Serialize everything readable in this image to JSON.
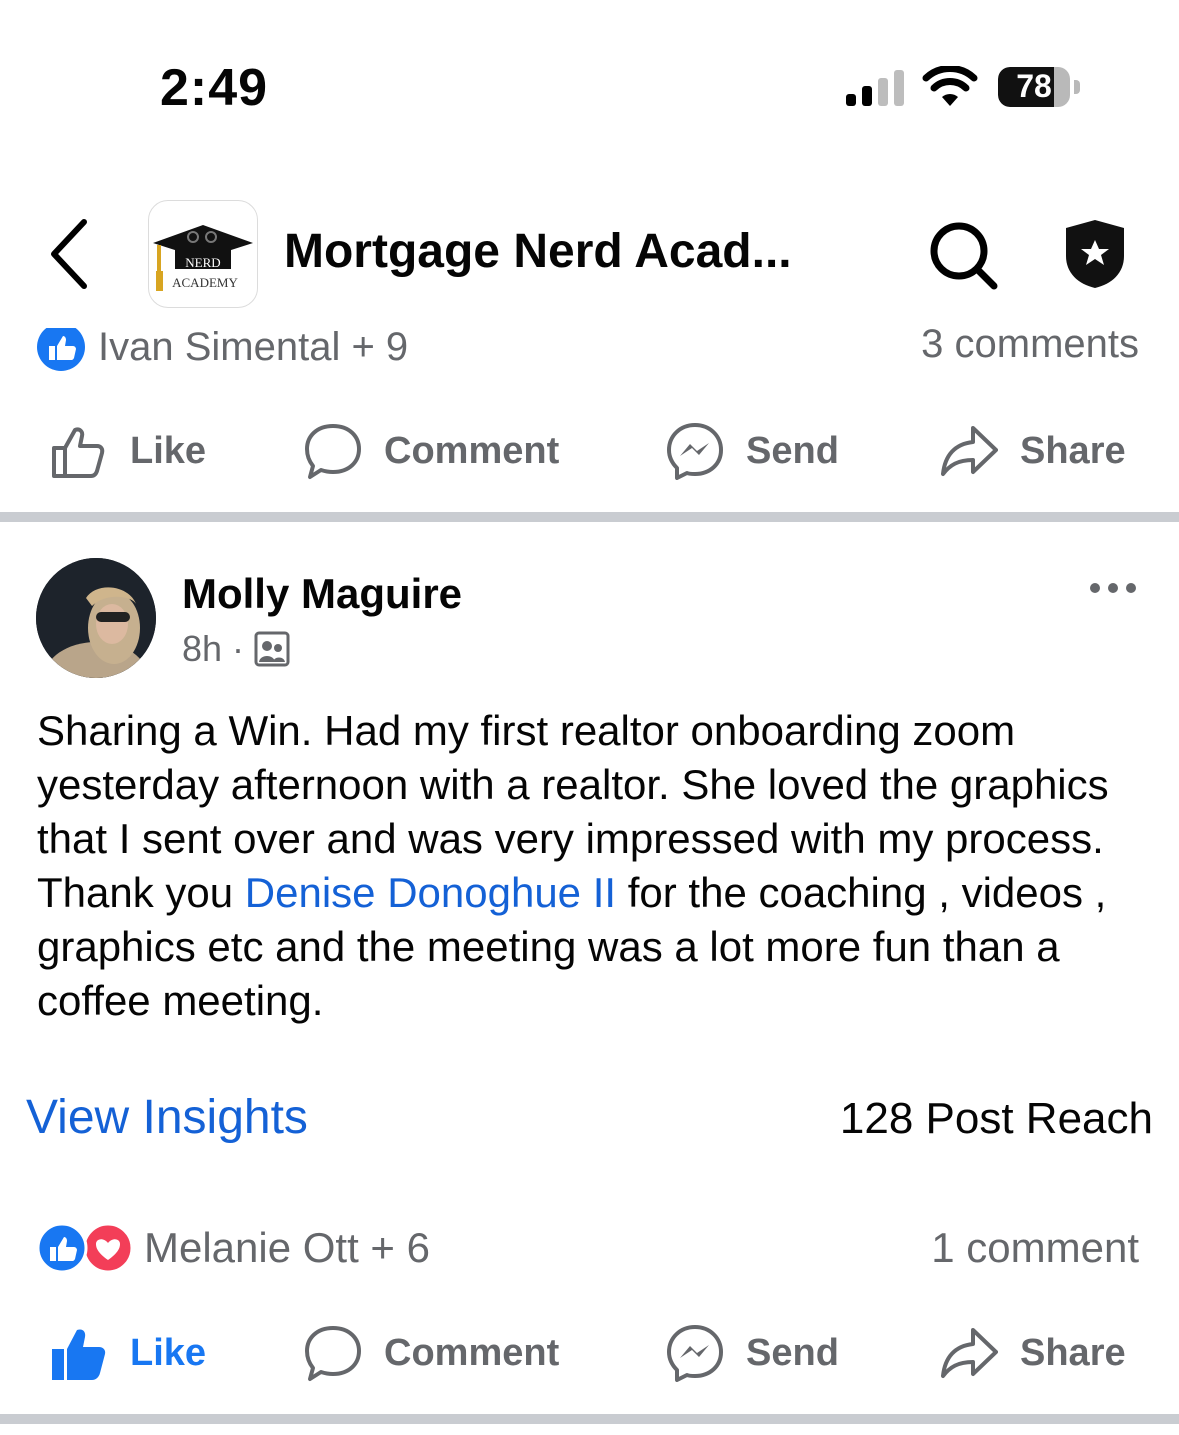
{
  "status_bar": {
    "time": "2:49",
    "battery": "78",
    "battery_level": 0.78
  },
  "header": {
    "title": "Mortgage Nerd Acad...",
    "logo_top": "NERD",
    "logo_bottom": "ACADEMY"
  },
  "previous_post": {
    "reactors": "Ivan Simental + 9",
    "comments": "3 comments",
    "actions": {
      "like": "Like",
      "comment": "Comment",
      "send": "Send",
      "share": "Share"
    }
  },
  "post": {
    "author": "Molly Maguire",
    "time": "8h",
    "text_before": "Sharing a Win.  Had my first realtor onboarding zoom yesterday afternoon with a realtor.  She loved the graphics that I sent over and was very impressed with my process. Thank you ",
    "mention": "Denise Donoghue II",
    "text_after": " for the coaching , videos , graphics etc and the meeting was a lot more fun than a coffee meeting.",
    "insights_label": "View Insights",
    "reach": "128 Post Reach",
    "reactors": "Melanie Ott + 6",
    "comments": "1 comment",
    "actions": {
      "like": "Like",
      "comment": "Comment",
      "send": "Send",
      "share": "Share"
    }
  },
  "colors": {
    "link_blue": "#1461d6",
    "like_blue": "#1877f2",
    "gray_text": "#65676b",
    "love_red": "#f33e58",
    "divider": "#c9ccd1"
  }
}
